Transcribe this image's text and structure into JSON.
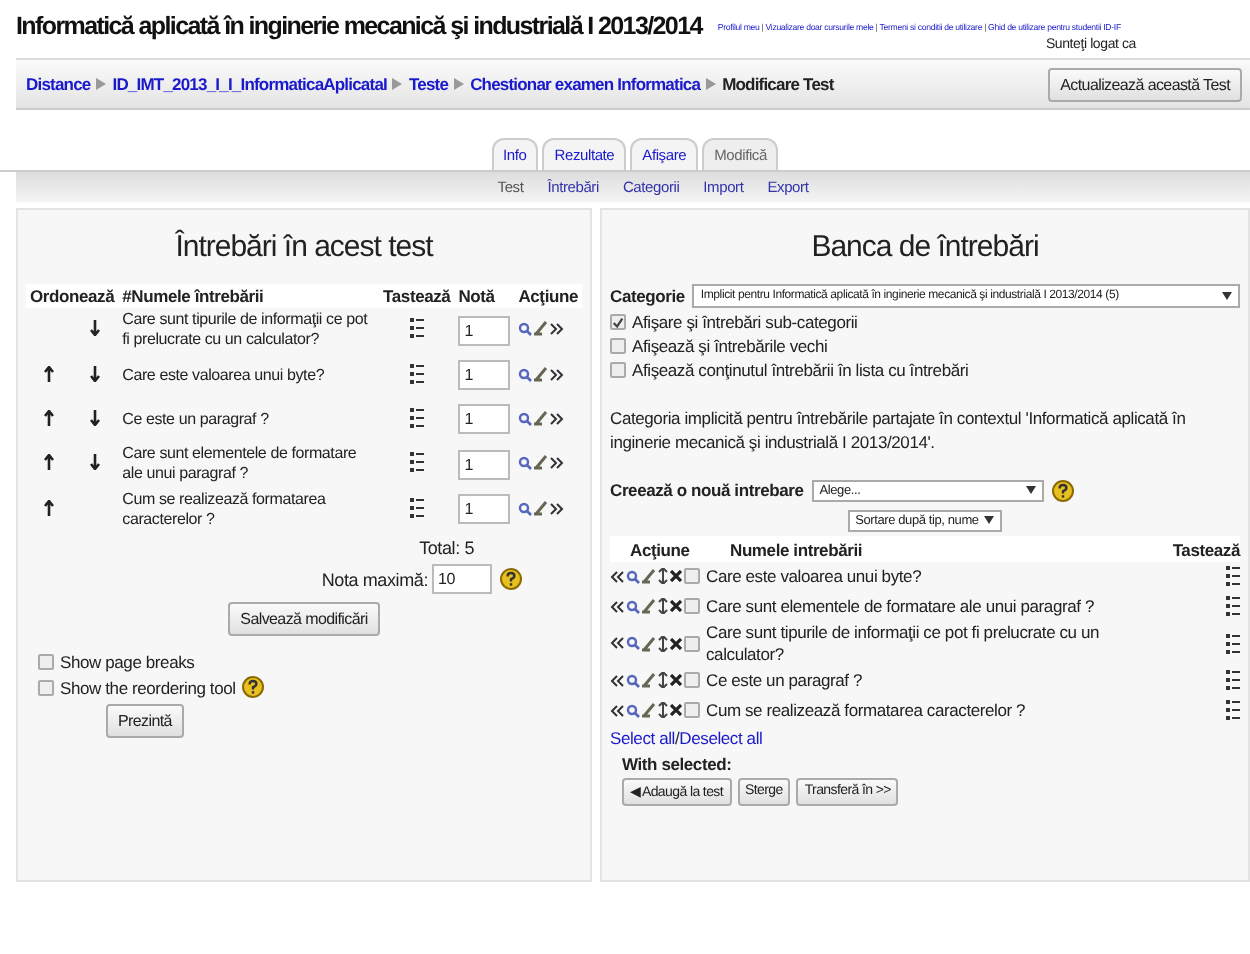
{
  "header": {
    "title": "Informatică aplicată în inginerie mecanică şi industrială I 2013/2014",
    "links": [
      "Profilul meu",
      "Vizualizare doar cursurile mele",
      "Termeni si conditii de utilizare",
      "Ghid de utilizare pentru studentii ID-IF"
    ],
    "separator": "|",
    "login": "Sunteţi logat ca"
  },
  "breadcrumb": {
    "items": [
      "Distance",
      "ID_IMT_2013_I_I_InformaticaAplicataI",
      "Teste",
      "Chestionar examen Informatica"
    ],
    "current": "Modificare Test",
    "button": "Actualizează această Test"
  },
  "tabs": [
    {
      "label": "Info",
      "selected": false
    },
    {
      "label": "Rezultate",
      "selected": false
    },
    {
      "label": "Afişare",
      "selected": false
    },
    {
      "label": "Modifică",
      "selected": true
    }
  ],
  "subtabs": [
    {
      "label": "Test",
      "selected": true
    },
    {
      "label": "Întrebări",
      "selected": false
    },
    {
      "label": "Categorii",
      "selected": false
    },
    {
      "label": "Import",
      "selected": false
    },
    {
      "label": "Export",
      "selected": false
    }
  ],
  "left": {
    "heading": "Întrebări în acest test",
    "columns": [
      "Ordonează",
      "#",
      "Numele întrebării",
      "Tastează",
      "Notă",
      "Acţiune"
    ],
    "rows": [
      {
        "up": false,
        "down": true,
        "name": "Care sunt tipurile de informaţii ce pot fi prelucrate cu un calculator?",
        "grade": "1"
      },
      {
        "up": true,
        "down": true,
        "name": "Care este valoarea unui byte?",
        "grade": "1"
      },
      {
        "up": true,
        "down": true,
        "name": "Ce este un paragraf ?",
        "grade": "1"
      },
      {
        "up": true,
        "down": true,
        "name": "Care sunt elementele de formatare ale unui paragraf ?",
        "grade": "1"
      },
      {
        "up": true,
        "down": false,
        "name": "Cum se realizează formatarea caracterelor ?",
        "grade": "1"
      }
    ],
    "total": "Total: 5",
    "max_label": "Nota maximă:",
    "max_value": "10",
    "save": "Salvează modificări",
    "options": [
      {
        "label": "Show page breaks",
        "checked": false,
        "help": false
      },
      {
        "label": "Show the reordering tool",
        "checked": false,
        "help": true
      }
    ],
    "preview": "Prezintă"
  },
  "right": {
    "heading": "Banca de întrebări",
    "category_label": "Categorie",
    "category_value": "Implicit pentru Informatică aplicată în inginerie mecanică şi industrială I 2013/2014 (5)",
    "options": [
      {
        "label": "Afişare şi întrebări sub-categorii",
        "checked": true
      },
      {
        "label": "Afişează şi întrebările vechi",
        "checked": false
      },
      {
        "label": "Afişează conţinutul întrebării în lista cu întrebări",
        "checked": false
      }
    ],
    "info": "Categoria implicită pentru întrebările partajate în contextul 'Informatică aplicată în inginerie mecanică şi industrială I 2013/2014'.",
    "create_label": "Creează o nouă intrebare",
    "create_value": "Alege...",
    "sort_value": "Sortare după tip, nume",
    "columns": [
      "Acţiune",
      "Numele intrebării",
      "Tastează"
    ],
    "rows": [
      {
        "name": "Care este valoarea unui byte?",
        "checked": false
      },
      {
        "name": "Care sunt elementele de formatare ale unui paragraf ?",
        "checked": false
      },
      {
        "name": "Care sunt tipurile de informaţii ce pot fi prelucrate cu un calculator?",
        "checked": false
      },
      {
        "name": "Ce este un paragraf ?",
        "checked": false
      },
      {
        "name": "Cum se realizează formatarea caracterelor ?",
        "checked": false
      }
    ],
    "select_all": "Select all",
    "sep": "/",
    "deselect_all": "Deselect all",
    "with_selected": "With selected:",
    "buttons": [
      "◀ Adaugă la test",
      "Sterge",
      "Transferă în >>"
    ]
  }
}
